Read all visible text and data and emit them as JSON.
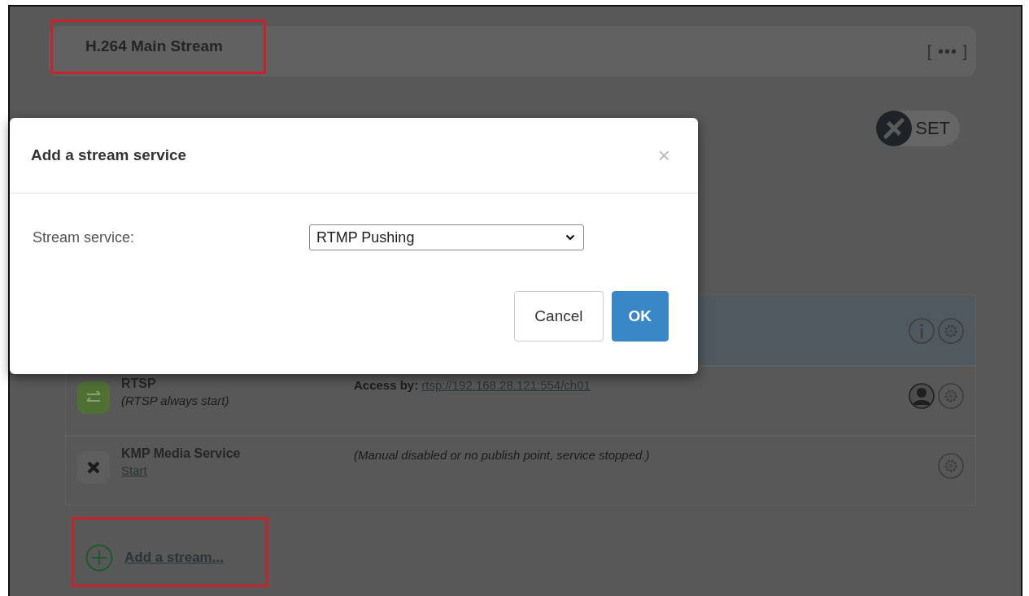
{
  "panel": {
    "title": "H.264 Main Stream",
    "title_highlighted": true,
    "menu": "[ ••• ]",
    "set_button": "SET"
  },
  "services": [
    {
      "selected": true,
      "kind": "info"
    },
    {
      "selected": false,
      "kind": "running",
      "name": "RTSP",
      "note": "(RTSP always start)",
      "access_label": "Access by:",
      "access_link": "rtsp://192.168.28.121:554/ch01"
    },
    {
      "selected": false,
      "kind": "stopped",
      "name": "KMP Media Service",
      "action": "Start",
      "message": "(Manual disabled or no publish point, service stopped.)"
    }
  ],
  "add_stream": {
    "label": "Add a stream...",
    "highlighted": true
  },
  "dialog": {
    "title": "Add a stream service",
    "close": "×",
    "field_label": "Stream service:",
    "value": "RTMP Pushing",
    "buttons": [
      {
        "label": "Cancel",
        "kind": "default"
      },
      {
        "label": "OK",
        "kind": "primary"
      }
    ]
  }
}
